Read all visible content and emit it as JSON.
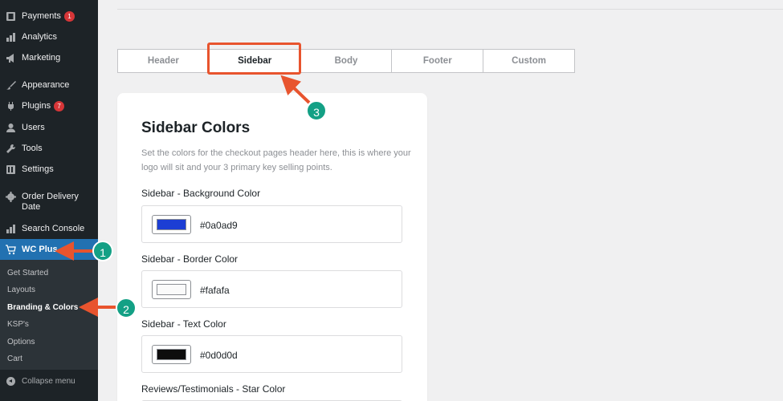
{
  "sidebar": {
    "items": [
      {
        "label": "Payments",
        "badge": "1",
        "icon": "payments-icon"
      },
      {
        "label": "Analytics",
        "icon": "analytics-icon"
      },
      {
        "label": "Marketing",
        "icon": "marketing-icon"
      },
      {
        "label": "Appearance",
        "icon": "appearance-icon"
      },
      {
        "label": "Plugins",
        "badge": "7",
        "icon": "plugins-icon"
      },
      {
        "label": "Users",
        "icon": "users-icon"
      },
      {
        "label": "Tools",
        "icon": "tools-icon"
      },
      {
        "label": "Settings",
        "icon": "settings-icon"
      },
      {
        "label": "Order Delivery",
        "label2": "Date",
        "icon": "gear-icon"
      },
      {
        "label": "Search Console",
        "icon": "search-console-icon"
      },
      {
        "label": "WC Plus",
        "icon": "cart-icon"
      }
    ],
    "submenu": [
      "Get Started",
      "Layouts",
      "Branding & Colors",
      "KSP's",
      "Options",
      "Cart"
    ],
    "collapse_label": "Collapse menu"
  },
  "tabs": [
    "Header",
    "Sidebar",
    "Body",
    "Footer",
    "Custom"
  ],
  "card": {
    "title": "Sidebar Colors",
    "description": "Set the colors for the checkout pages header here, this is where your logo will sit and your 3 primary key selling points.",
    "fields": [
      {
        "label": "Sidebar - Background Color",
        "value": "#0a0ad9",
        "swatch": "#1c3ed4"
      },
      {
        "label": "Sidebar - Border Color",
        "value": "#fafafa",
        "swatch": "#fafafa"
      },
      {
        "label": "Sidebar - Text Color",
        "value": "#0d0d0d",
        "swatch": "#0d0d0d"
      },
      {
        "label": "Reviews/Testimonials - Star Color"
      }
    ]
  },
  "annotations": [
    "1",
    "2",
    "3"
  ],
  "colors": {
    "accent": "#2271b1",
    "annotation_arrow": "#e8542e",
    "annotation_badge": "#13a085"
  }
}
